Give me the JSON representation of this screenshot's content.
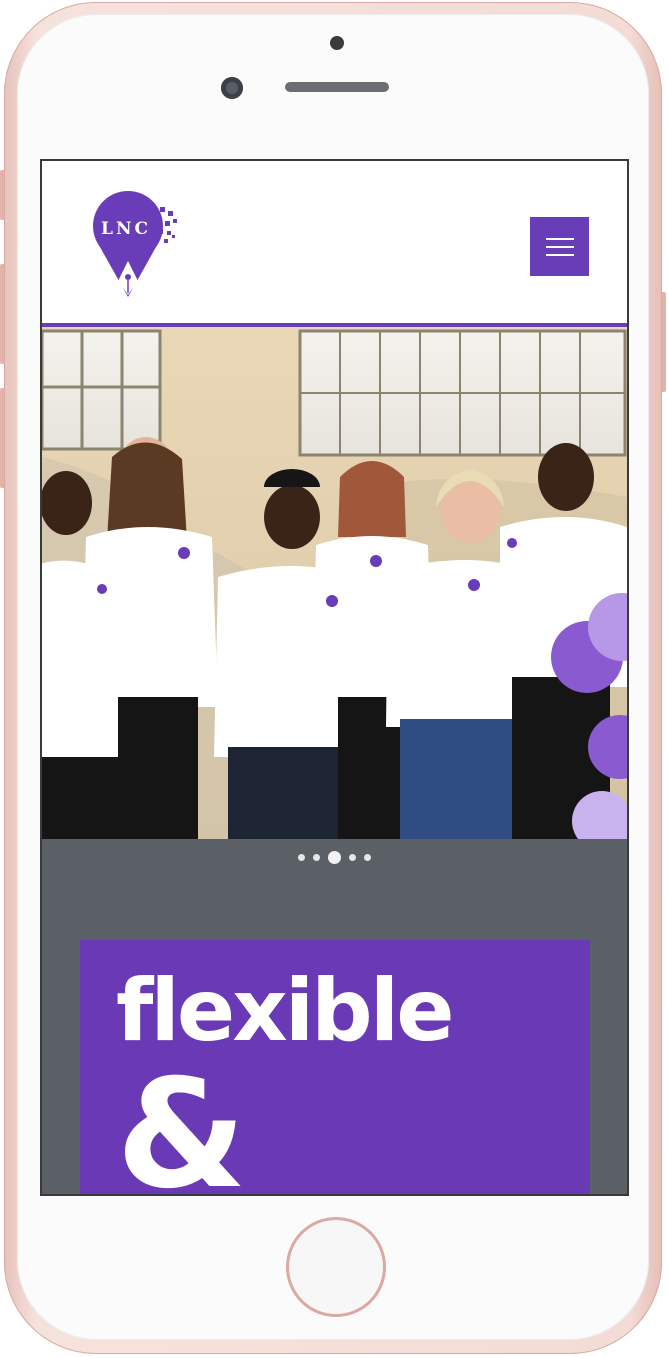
{
  "brand": {
    "logo_text": "LNC",
    "accent_color": "#6a3db8"
  },
  "header": {
    "menu_icon": "hamburger-icon"
  },
  "carousel": {
    "slide_count": 5,
    "active_index": 2
  },
  "promo": {
    "line1": "flexible",
    "line2": "&",
    "background": "#6a3ab6"
  },
  "device": {
    "frame_color": "#f4dcd6"
  }
}
